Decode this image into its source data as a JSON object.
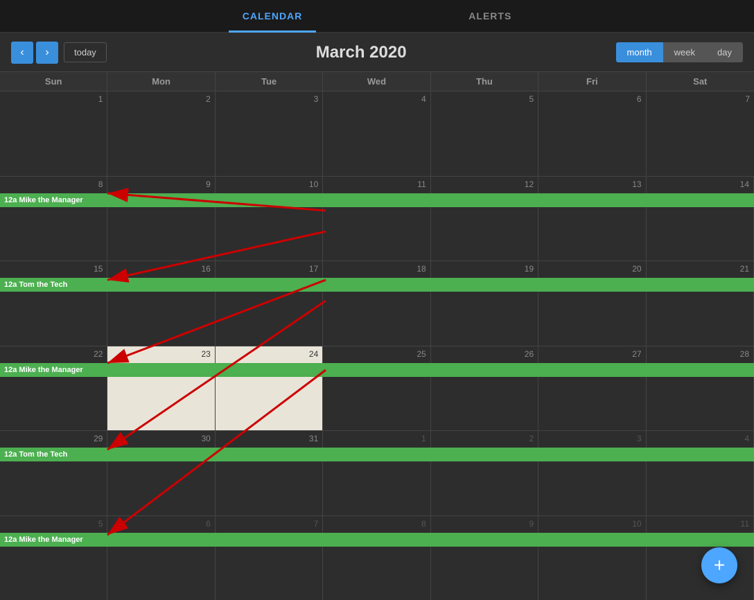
{
  "nav": {
    "tabs": [
      {
        "id": "calendar",
        "label": "CALENDAR",
        "active": true
      },
      {
        "id": "alerts",
        "label": "ALERTS",
        "active": false
      }
    ]
  },
  "header": {
    "prev_label": "‹",
    "next_label": "›",
    "today_label": "today",
    "title": "March 2020",
    "view_buttons": [
      {
        "id": "month",
        "label": "month",
        "active": true
      },
      {
        "id": "week",
        "label": "week",
        "active": false
      },
      {
        "id": "day",
        "label": "day",
        "active": false
      }
    ]
  },
  "day_headers": [
    "Sun",
    "Mon",
    "Tue",
    "Wed",
    "Thu",
    "Fri",
    "Sat"
  ],
  "weeks": [
    {
      "days": [
        1,
        2,
        3,
        4,
        5,
        6,
        7
      ],
      "other": [],
      "events": []
    },
    {
      "days": [
        8,
        9,
        10,
        11,
        12,
        13,
        14
      ],
      "other": [],
      "events": [
        {
          "label": "12a Mike the Manager",
          "start_col": 0,
          "span": 7
        }
      ]
    },
    {
      "days": [
        15,
        16,
        17,
        18,
        19,
        20,
        21
      ],
      "other": [],
      "events": [
        {
          "label": "12a Tom the Tech",
          "start_col": 0,
          "span": 7
        }
      ]
    },
    {
      "days": [
        22,
        23,
        24,
        25,
        26,
        27,
        28
      ],
      "other": [],
      "events": [
        {
          "label": "12a Mike the Manager",
          "start_col": 0,
          "span": 7
        }
      ]
    },
    {
      "days": [
        29,
        30,
        31,
        1,
        2,
        3,
        4
      ],
      "other": [
        3,
        4,
        5,
        6
      ],
      "events": [
        {
          "label": "12a Tom the Tech",
          "start_col": 0,
          "span": 7
        }
      ]
    },
    {
      "days": [
        5,
        6,
        7,
        8,
        9,
        10,
        11
      ],
      "other": [
        0,
        1,
        2,
        3,
        4,
        5,
        6
      ],
      "events": [
        {
          "label": "12a Mike the Manager",
          "start_col": 0,
          "span": 7
        }
      ]
    }
  ],
  "fab": {
    "label": "+"
  }
}
